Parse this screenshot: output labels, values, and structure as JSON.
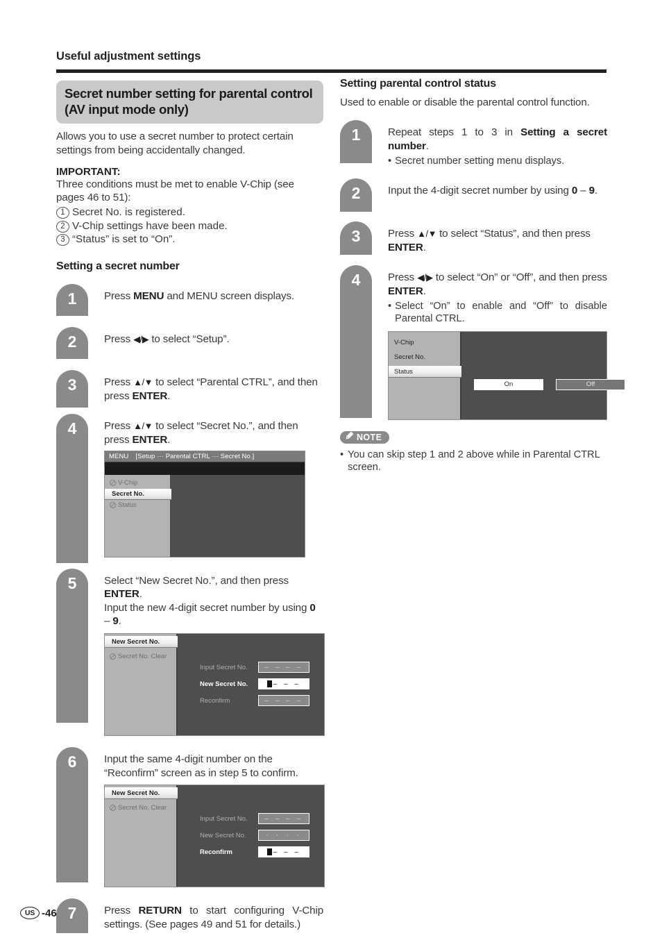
{
  "running_head": "Useful adjustment settings",
  "left_column": {
    "section_title": "Secret number setting for parental control (AV input mode only)",
    "intro": "Allows you to use a secret number to protect certain settings from being accidentally changed.",
    "important_label": "IMPORTANT:",
    "important_text": "Three conditions must be met to enable V-Chip (see pages 46 to 51):",
    "conditions": [
      {
        "num": "1",
        "text": "Secret No. is registered."
      },
      {
        "num": "2",
        "text": "V-Chip settings have been made."
      },
      {
        "num": "3",
        "text": "“Status” is set to “On”."
      }
    ],
    "subhead": "Setting a secret number",
    "steps": [
      {
        "num": "1",
        "text_html": "Press <b>MENU</b> and MENU screen displays."
      },
      {
        "num": "2",
        "text_html": "Press <span class=\"arrow\">◀/▶</span> to select “Setup”."
      },
      {
        "num": "3",
        "text_html": "Press <span class=\"arrow\">▲/▼</span> to select “Parental CTRL”, and then press <b>ENTER</b>."
      },
      {
        "num": "4",
        "text_html": "Press <span class=\"arrow\">▲/▼</span> to select “Secret No.”, and then press <b>ENTER</b>."
      },
      {
        "num": "5",
        "text_html": "Select “New Secret No.”, and then press <b>ENTER</b>.<br>Input the new 4-digit secret number by using <b>0</b> – <b>9</b>."
      },
      {
        "num": "6",
        "text_html": "Input the same 4-digit number on the “Reconfirm” screen as in step 5 to confirm."
      },
      {
        "num": "7",
        "text_html": "Press <b>RETURN</b> to start configuring V-Chip settings. (See pages 49 and 51 for details.)"
      }
    ]
  },
  "osd_menu": {
    "menu_word": "MENU",
    "breadcrumb": "[Setup ··· Parental CTRL ··· Secret No.]",
    "items": [
      {
        "label": "V-Chip",
        "state": "disabled"
      },
      {
        "label": "Secret No.",
        "state": "selected"
      },
      {
        "label": "Status",
        "state": "disabled"
      }
    ]
  },
  "osd_secret_step5": {
    "items": [
      {
        "label": "New Secret No.",
        "state": "selected"
      },
      {
        "label": "Secret No. Clear",
        "state": "disabled"
      }
    ],
    "fields": [
      {
        "label": "Input Secret No.",
        "state": "inactive",
        "value": "– – – –"
      },
      {
        "label": "New Secret No.",
        "state": "active",
        "value": "– – –"
      },
      {
        "label": "Reconfirm",
        "state": "inactive",
        "value": "– – – –"
      }
    ]
  },
  "osd_secret_step6": {
    "items": [
      {
        "label": "New Secret No.",
        "state": "selected"
      },
      {
        "label": "Secret No. Clear",
        "state": "disabled"
      }
    ],
    "fields": [
      {
        "label": "Input Secret No.",
        "state": "inactive",
        "value": "– – – –"
      },
      {
        "label": "New Secret No.",
        "state": "filled",
        "value": "· · · ·"
      },
      {
        "label": "Reconfirm",
        "state": "active",
        "value": "– – –"
      }
    ]
  },
  "right_column": {
    "subhead": "Setting parental control status",
    "intro": "Used to enable or disable the parental control function.",
    "steps": [
      {
        "num": "1",
        "text_html": "Repeat steps 1 to 3 in <b>Setting a secret number</b>.",
        "bullet": "Secret number setting menu displays."
      },
      {
        "num": "2",
        "text_html": "Input the 4-digit secret number by using <b>0</b> – <b>9</b>."
      },
      {
        "num": "3",
        "text_html": "Press <span class=\"arrow\">▲/▼</span> to select “Status”, and then press <b>ENTER</b>."
      },
      {
        "num": "4",
        "text_html": "Press <span class=\"arrow\">◀/▶</span> to select “On” or “Off”, and then press <b>ENTER</b>.",
        "bullet": "Select “On” to enable and “Off” to disable Parental CTRL."
      }
    ],
    "osd_status": {
      "items": [
        {
          "label": "V-Chip",
          "state": "normal"
        },
        {
          "label": "Secret No.",
          "state": "normal"
        },
        {
          "label": "Status",
          "state": "selected"
        }
      ],
      "buttons": [
        {
          "label": "On",
          "state": "selected"
        },
        {
          "label": "Off",
          "state": "normal"
        }
      ]
    },
    "note": {
      "badge": "NOTE",
      "icon": "pencil-icon",
      "text": "You can skip step 1 and 2 above while in Parental CTRL screen."
    }
  },
  "footer": {
    "region": "US",
    "page": "-46"
  },
  "colors": {
    "marker_gray": "#8a8a8a",
    "banner_gray": "#c9c9c9",
    "osd_dark": "#4e4e4e",
    "osd_panel": "#b3b3b3"
  }
}
